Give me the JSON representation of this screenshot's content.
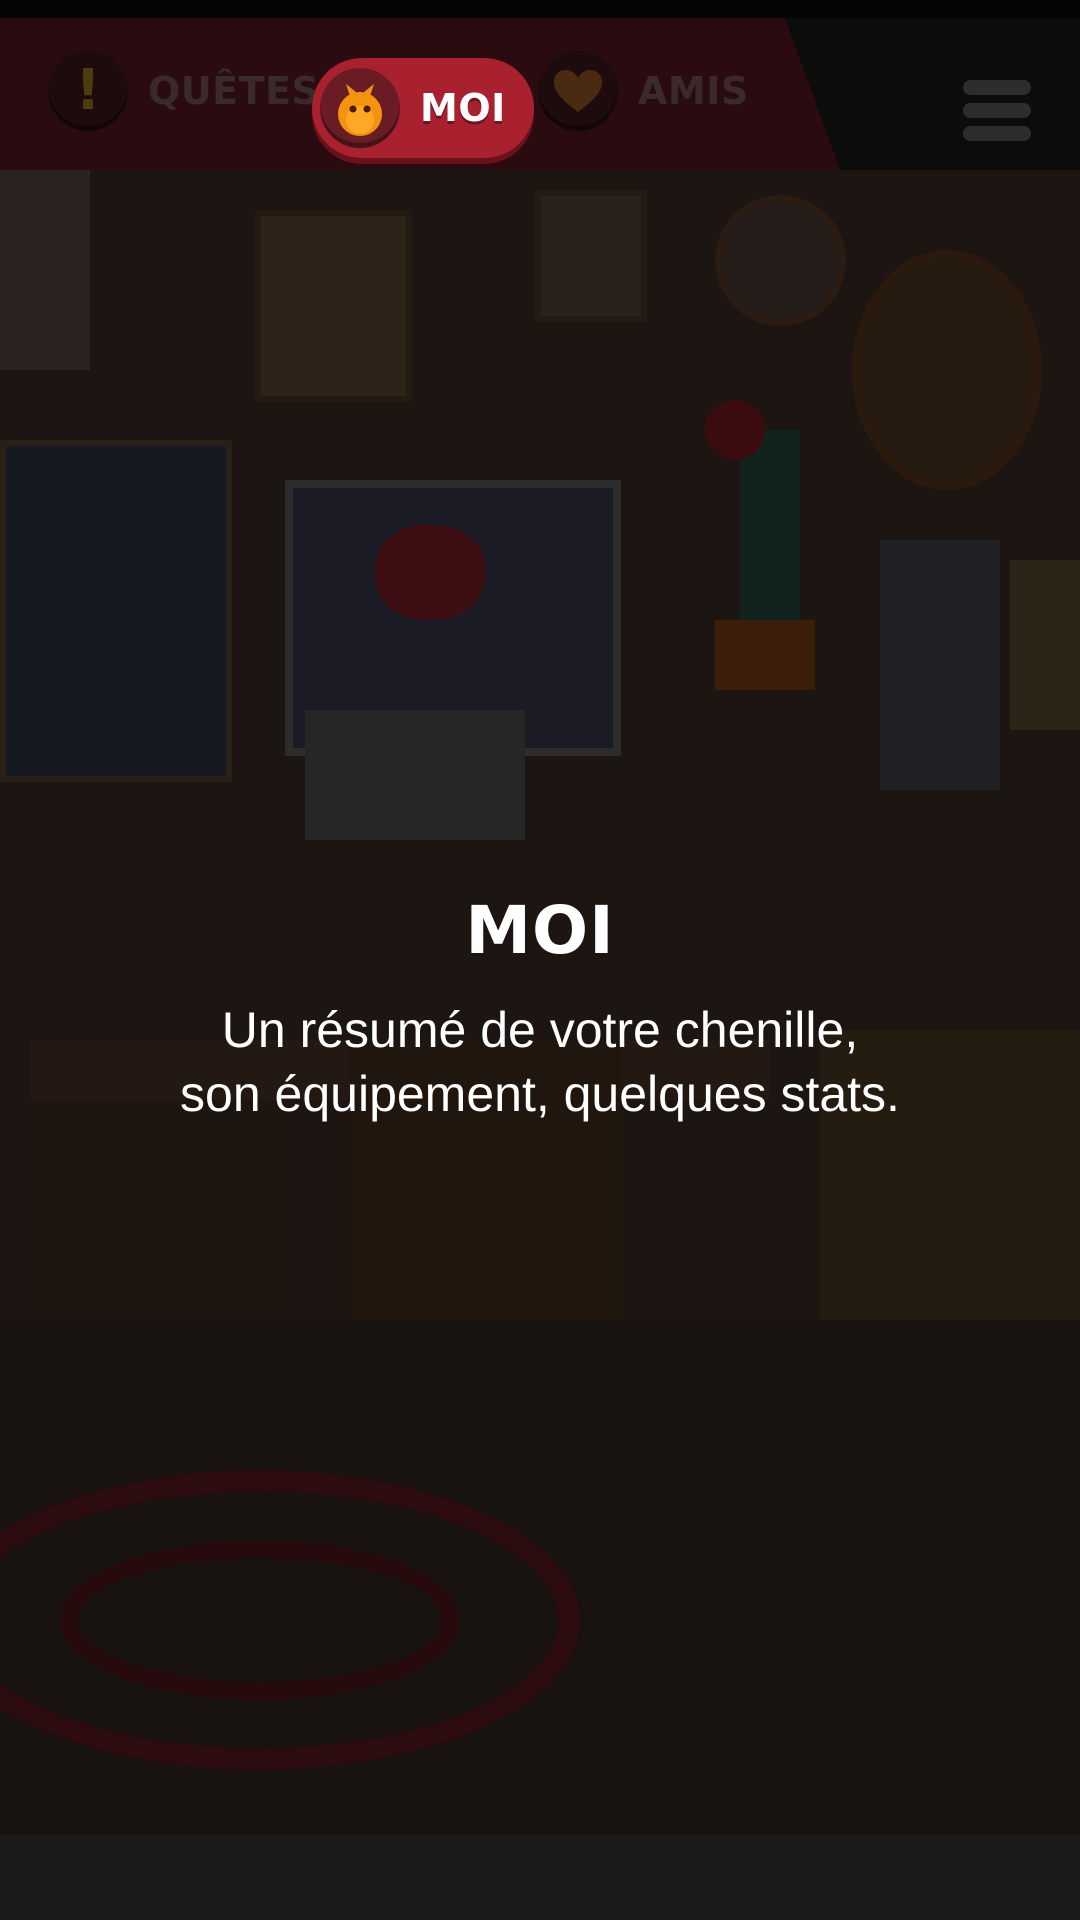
{
  "nav": {
    "tabs": [
      {
        "label": "QUÊTES",
        "icon": "exclamation-icon"
      },
      {
        "label": "MOI",
        "icon": "caterpillar-icon",
        "active": true
      },
      {
        "label": "AMIS",
        "icon": "heart-icon"
      }
    ],
    "menu_icon": "hamburger-menu-icon"
  },
  "overlay": {
    "title": "MOI",
    "description_line1": "Un résumé de votre chenille,",
    "description_line2": "son équipement, quelques stats."
  },
  "colors": {
    "nav_banner": "#2a0c10",
    "active_tab": "#a9202f",
    "caterpillar": "#f39410",
    "text": "#ffffff",
    "background": "#1a1a1a"
  }
}
